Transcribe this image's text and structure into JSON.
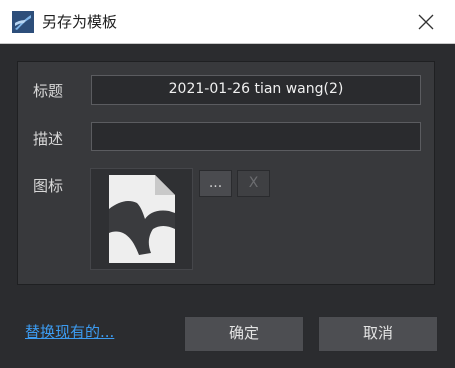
{
  "window": {
    "title": "另存为模板",
    "app_icon": "blackmagic-logo-icon",
    "close_icon": "close-icon"
  },
  "form": {
    "title_label": "标题",
    "title_value": "2021-01-26 tian wang(2)",
    "description_label": "描述",
    "description_value": "",
    "icon_label": "图标",
    "browse_button": "...",
    "clear_button": "X"
  },
  "footer": {
    "replace_link": "替换现有的...",
    "ok_button": "确定",
    "cancel_button": "取消"
  },
  "colors": {
    "background": "#2b2c2f",
    "panel": "#38393c",
    "link": "#3c9bf0"
  }
}
